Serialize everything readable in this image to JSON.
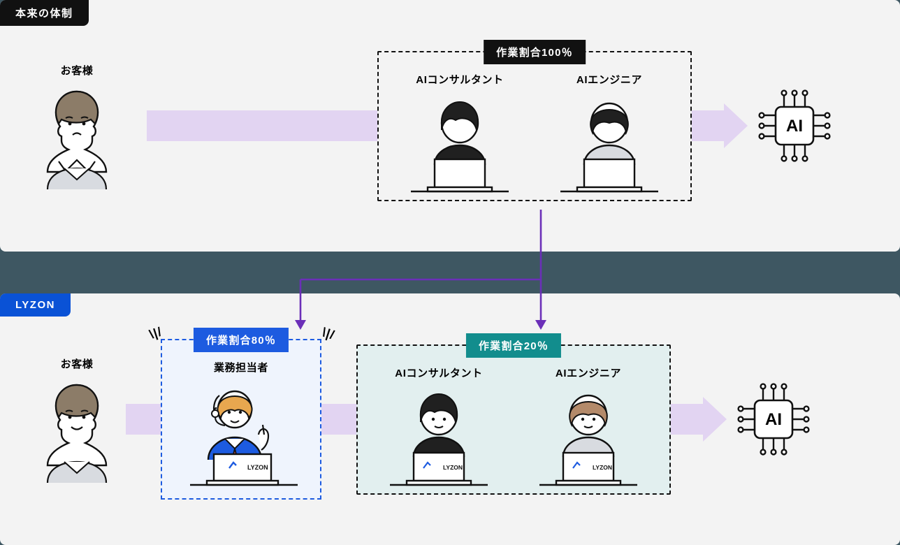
{
  "top": {
    "tag": "本来の体制",
    "customer_label": "お客様",
    "box_badge": "作業割合100％",
    "people": [
      {
        "label": "AIコンサルタント"
      },
      {
        "label": "AIエンジニア"
      }
    ],
    "ai_label": "AI"
  },
  "bottom": {
    "tag": "LYZON",
    "customer_label": "お客様",
    "operator_box": {
      "badge": "作業割合80％",
      "label": "業務担当者",
      "laptop_logo": "LYZON"
    },
    "right_box": {
      "badge": "作業割合20％",
      "people": [
        {
          "label": "AIコンサルタント",
          "laptop_logo": "LYZON"
        },
        {
          "label": "AIエンジニア",
          "laptop_logo": "LYZON"
        }
      ]
    },
    "ai_label": "AI"
  },
  "colors": {
    "arrow": "#e2d4f2",
    "connector": "#6b2fb8",
    "blue": "#1d5be0",
    "teal": "#128d8d"
  }
}
